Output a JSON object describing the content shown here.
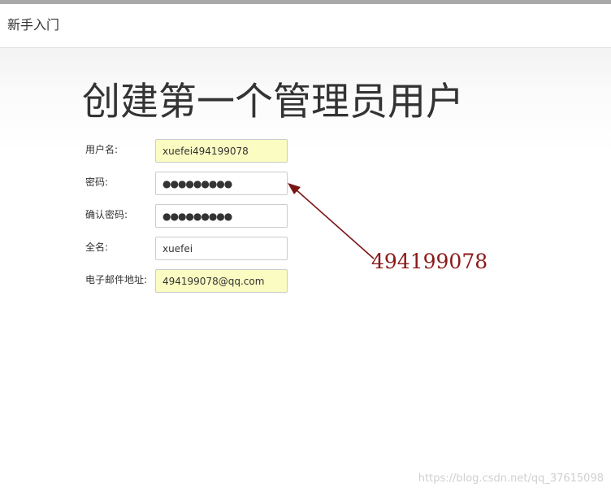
{
  "header": {
    "title": "新手入门"
  },
  "page": {
    "title": "创建第一个管理员用户"
  },
  "form": {
    "username": {
      "label": "用户名:",
      "value": "xuefei494199078"
    },
    "password": {
      "label": "密码:",
      "value": "●●●●●●●●●"
    },
    "confirm_password": {
      "label": "确认密码:",
      "value": "●●●●●●●●●"
    },
    "full_name": {
      "label": "全名:",
      "value": "xuefei"
    },
    "email": {
      "label": "电子邮件地址:",
      "value": "494199078@qq.com"
    }
  },
  "annotation": {
    "text": "494199078",
    "color": "#8b1a1a"
  },
  "watermark": {
    "text": "https://blog.csdn.net/qq_37615098"
  },
  "colors": {
    "autofill_background": "#fafcc2",
    "input_border": "#cccccc"
  }
}
